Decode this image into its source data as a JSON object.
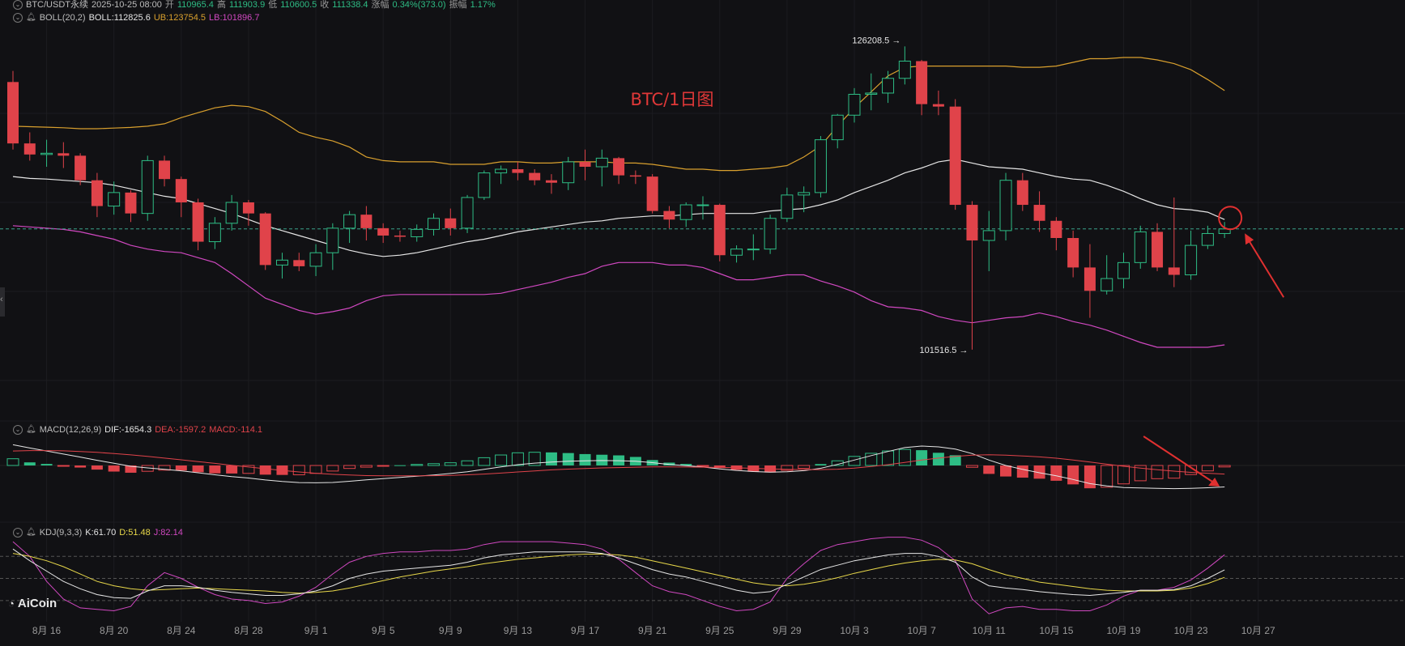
{
  "header": {
    "symbol": "BTC/USDT永续",
    "datetime": "2025-10-25 08:00",
    "open_label": "开",
    "open": "110965.4",
    "high_label": "高",
    "high": "111903.9",
    "low_label": "低",
    "low": "110600.5",
    "close_label": "收",
    "close": "111338.4",
    "change_label": "涨幅",
    "change": "0.34%(373.0)",
    "amp_label": "振幅",
    "amp": "1.17%"
  },
  "boll": {
    "name": "BOLL(20,2)",
    "mid": "BOLL:112825.6",
    "ub": "UB:123754.5",
    "lb": "LB:101896.7"
  },
  "macd": {
    "name": "MACD(12,26,9)",
    "dif": "DIF:-1654.3",
    "dea": "DEA:-1597.2",
    "macd": "MACD:-114.1"
  },
  "kdj": {
    "name": "KDJ(9,3,3)",
    "k": "K:61.70",
    "d": "D:51.48",
    "j": "J:82.14"
  },
  "logo": "AiCoin",
  "colors": {
    "up": "#2ebd85",
    "down": "#e0434a",
    "ub": "#d9a02e",
    "mid": "#e6e6e6",
    "lb": "#d048c0",
    "dif": "#e6e6e6",
    "dea": "#e0434a",
    "k": "#e6e6e6",
    "d": "#e8d84a",
    "j": "#d048c0",
    "annotation": "#e03030"
  },
  "chart_data": {
    "type": "candlestick",
    "title": "BTC/1日图",
    "dates": [
      "08-14",
      "08-15",
      "08-16",
      "08-17",
      "08-18",
      "08-19",
      "08-20",
      "08-21",
      "08-22",
      "08-23",
      "08-24",
      "08-25",
      "08-26",
      "08-27",
      "08-28",
      "08-29",
      "08-30",
      "08-31",
      "09-01",
      "09-02",
      "09-03",
      "09-04",
      "09-05",
      "09-06",
      "09-07",
      "09-08",
      "09-09",
      "09-10",
      "09-11",
      "09-12",
      "09-13",
      "09-14",
      "09-15",
      "09-16",
      "09-17",
      "09-18",
      "09-19",
      "09-20",
      "09-21",
      "09-22",
      "09-23",
      "09-24",
      "09-25",
      "09-26",
      "09-27",
      "09-28",
      "09-29",
      "09-30",
      "10-01",
      "10-02",
      "10-03",
      "10-04",
      "10-05",
      "10-06",
      "10-07",
      "10-08",
      "10-09",
      "10-10",
      "10-11",
      "10-12",
      "10-13",
      "10-14",
      "10-15",
      "10-16",
      "10-17",
      "10-18",
      "10-19",
      "10-20",
      "10-21",
      "10-22",
      "10-23",
      "10-24",
      "10-25"
    ],
    "open": [
      123300,
      118300,
      117400,
      117500,
      117300,
      115300,
      113200,
      114300,
      112600,
      116900,
      115400,
      113500,
      110300,
      111800,
      113500,
      112600,
      108400,
      108800,
      108300,
      109400,
      111400,
      112500,
      111400,
      110800,
      110700,
      111300,
      112200,
      111400,
      113900,
      115900,
      116200,
      115900,
      115300,
      115100,
      116800,
      116400,
      117100,
      115700,
      115600,
      112800,
      112100,
      113300,
      113300,
      109200,
      109700,
      109700,
      112200,
      114100,
      114300,
      118600,
      120600,
      122300,
      122400,
      123600,
      125000,
      121500,
      121300,
      113300,
      110400,
      111200,
      115300,
      113300,
      112000,
      110600,
      108200,
      106300,
      107300,
      108600,
      111100,
      108200,
      107600,
      110000,
      110965
    ],
    "close": [
      118300,
      117400,
      117500,
      117300,
      115300,
      113200,
      114300,
      112600,
      116900,
      115400,
      113500,
      110300,
      111800,
      113500,
      112600,
      108400,
      108800,
      108300,
      109400,
      111400,
      112500,
      111400,
      110800,
      110700,
      111300,
      112200,
      111400,
      113900,
      115900,
      116200,
      115900,
      115300,
      115100,
      116800,
      116400,
      117100,
      115700,
      115600,
      112800,
      112100,
      113300,
      113300,
      109200,
      109700,
      109700,
      112200,
      114100,
      114300,
      118600,
      120600,
      122300,
      122400,
      123600,
      125000,
      121500,
      121300,
      113300,
      110400,
      111200,
      115300,
      113300,
      112000,
      110600,
      108200,
      106300,
      107300,
      108600,
      111100,
      108200,
      107600,
      110000,
      110965,
      111338
    ],
    "high": [
      124200,
      119200,
      118600,
      118400,
      117500,
      115900,
      115200,
      114500,
      117300,
      117300,
      115600,
      113800,
      112300,
      114100,
      113700,
      112700,
      109400,
      109400,
      110100,
      111800,
      112800,
      113200,
      111800,
      111200,
      111700,
      112600,
      113000,
      114100,
      116100,
      116500,
      116800,
      116200,
      115800,
      117200,
      117800,
      117800,
      117200,
      116100,
      115800,
      113200,
      113500,
      114000,
      113400,
      110000,
      110900,
      112500,
      114700,
      114800,
      118900,
      120700,
      122800,
      124000,
      124200,
      126200,
      125100,
      122600,
      121900,
      113600,
      112800,
      115900,
      115900,
      114400,
      112300,
      111200,
      110100,
      109200,
      109400,
      111600,
      111800,
      113900,
      111200,
      111600,
      111904
    ],
    "low": [
      117800,
      116900,
      116400,
      116300,
      114900,
      112300,
      112500,
      111900,
      112000,
      114800,
      112300,
      109600,
      109700,
      111200,
      111600,
      108000,
      107300,
      107900,
      107500,
      108000,
      110200,
      110400,
      110200,
      110300,
      110300,
      110800,
      110800,
      111000,
      113700,
      115000,
      115300,
      114900,
      114200,
      114500,
      115300,
      114800,
      115000,
      115000,
      112600,
      111400,
      111500,
      112100,
      108700,
      108600,
      108800,
      109300,
      111900,
      112700,
      113900,
      117900,
      120000,
      121000,
      121600,
      123100,
      120600,
      120600,
      112900,
      101516,
      107900,
      110400,
      112800,
      111100,
      109600,
      107400,
      104100,
      106000,
      106500,
      108100,
      107900,
      106600,
      107200,
      109700,
      110600
    ],
    "boll_ub": [
      119700,
      119660,
      119620,
      119580,
      119500,
      119500,
      119550,
      119600,
      119700,
      119900,
      120400,
      120800,
      121200,
      121400,
      121300,
      120900,
      120100,
      119200,
      118800,
      118500,
      118000,
      117200,
      116900,
      116800,
      116800,
      116800,
      116600,
      116600,
      116600,
      116800,
      116800,
      116700,
      116700,
      116800,
      116800,
      116800,
      116700,
      116700,
      116600,
      116400,
      116200,
      116200,
      116100,
      116100,
      116200,
      116300,
      116500,
      117200,
      118100,
      119700,
      121200,
      122500,
      123800,
      124500,
      124600,
      124600,
      124600,
      124600,
      124600,
      124600,
      124500,
      124500,
      124600,
      124900,
      125200,
      125200,
      125300,
      125300,
      125100,
      124800,
      124300,
      123500,
      122600
    ],
    "boll_mid": [
      115600,
      115450,
      115400,
      115300,
      115200,
      115100,
      114900,
      114600,
      114300,
      114000,
      113800,
      113400,
      113000,
      112600,
      112100,
      111600,
      111200,
      110800,
      110400,
      110000,
      109600,
      109300,
      109100,
      109200,
      109400,
      109700,
      110000,
      110300,
      110500,
      110800,
      111100,
      111300,
      111500,
      111700,
      111900,
      112000,
      112200,
      112300,
      112400,
      112400,
      112500,
      112600,
      112600,
      112600,
      112600,
      112800,
      112900,
      113000,
      113300,
      113700,
      114300,
      114800,
      115300,
      115900,
      116300,
      116800,
      117000,
      116700,
      116400,
      116300,
      116200,
      115900,
      115600,
      115400,
      115300,
      114900,
      114400,
      113800,
      113300,
      113000,
      112900,
      112700,
      112100
    ],
    "boll_lb": [
      111600,
      111500,
      111400,
      111300,
      111100,
      110800,
      110500,
      110000,
      109700,
      109500,
      109400,
      109000,
      108600,
      107700,
      106700,
      105700,
      105200,
      104700,
      104400,
      104600,
      104900,
      105500,
      105900,
      106000,
      106000,
      106000,
      106000,
      106000,
      106000,
      106100,
      106400,
      106700,
      107000,
      107400,
      107700,
      108300,
      108600,
      108600,
      108600,
      108400,
      108400,
      108200,
      107700,
      107200,
      107200,
      107400,
      107600,
      107600,
      107100,
      106700,
      106200,
      105500,
      105000,
      104900,
      104700,
      104200,
      103900,
      103700,
      103900,
      104100,
      104200,
      104500,
      104200,
      103800,
      103500,
      103100,
      102600,
      102100,
      101700,
      101700,
      101700,
      101700,
      101900
    ],
    "macd_hist": [
      520,
      240,
      120,
      -60,
      -160,
      -320,
      -470,
      -560,
      -450,
      -360,
      -390,
      -520,
      -610,
      -620,
      -610,
      -710,
      -730,
      -720,
      -610,
      -430,
      -230,
      -130,
      -60,
      20,
      80,
      140,
      210,
      360,
      600,
      810,
      980,
      1020,
      1010,
      960,
      880,
      830,
      780,
      660,
      420,
      220,
      120,
      -50,
      -200,
      -340,
      -480,
      -540,
      -380,
      -220,
      110,
      360,
      700,
      940,
      1120,
      1240,
      1180,
      980,
      790,
      -140,
      -650,
      -850,
      -940,
      -1020,
      -1180,
      -1460,
      -1760,
      -1680,
      -1420,
      -1180,
      -1020,
      -980,
      -700,
      -420,
      -114
    ],
    "macd_dif": [
      1600,
      1350,
      1120,
      880,
      650,
      400,
      170,
      -60,
      -190,
      -300,
      -410,
      -560,
      -720,
      -860,
      -970,
      -1120,
      -1240,
      -1320,
      -1340,
      -1310,
      -1220,
      -1110,
      -1010,
      -920,
      -830,
      -730,
      -620,
      -480,
      -300,
      -110,
      60,
      180,
      270,
      330,
      360,
      380,
      370,
      330,
      220,
      80,
      -20,
      -120,
      -260,
      -380,
      -470,
      -520,
      -480,
      -400,
      -220,
      80,
      420,
      760,
      1080,
      1380,
      1500,
      1440,
      1260,
      920,
      420,
      0,
      -300,
      -560,
      -800,
      -1080,
      -1400,
      -1580,
      -1700,
      -1740,
      -1760,
      -1790,
      -1760,
      -1720,
      -1654
    ],
    "macd_dea": [
      1120,
      1150,
      1150,
      1130,
      1080,
      1010,
      920,
      820,
      700,
      570,
      440,
      300,
      160,
      20,
      -120,
      -250,
      -380,
      -500,
      -600,
      -680,
      -740,
      -780,
      -800,
      -800,
      -800,
      -790,
      -760,
      -720,
      -660,
      -590,
      -500,
      -420,
      -340,
      -280,
      -230,
      -190,
      -160,
      -130,
      -110,
      -110,
      -120,
      -130,
      -150,
      -180,
      -220,
      -270,
      -300,
      -320,
      -320,
      -290,
      -200,
      -80,
      60,
      240,
      420,
      570,
      700,
      800,
      830,
      800,
      740,
      660,
      560,
      420,
      260,
      100,
      -60,
      -200,
      -330,
      -440,
      -530,
      -600,
      -1597
    ],
    "kdj_k": [
      90,
      74,
      60,
      46,
      36,
      28,
      24,
      23,
      33,
      40,
      40,
      38,
      34,
      31,
      29,
      27,
      27,
      29,
      33,
      40,
      50,
      56,
      60,
      62,
      64,
      66,
      68,
      72,
      78,
      82,
      84,
      86,
      86,
      86,
      86,
      84,
      78,
      70,
      62,
      56,
      52,
      46,
      40,
      34,
      30,
      32,
      42,
      52,
      62,
      68,
      74,
      78,
      82,
      84,
      84,
      80,
      72,
      52,
      40,
      37,
      35,
      32,
      30,
      28,
      27,
      29,
      31,
      34,
      34,
      35,
      40,
      50,
      61.7
    ],
    "kdj_d": [
      84,
      80,
      74,
      66,
      56,
      46,
      40,
      36,
      34,
      35,
      36,
      37,
      36,
      35,
      34,
      33,
      31,
      30,
      31,
      33,
      37,
      42,
      47,
      52,
      56,
      60,
      63,
      66,
      70,
      73,
      76,
      78,
      80,
      82,
      83,
      83,
      82,
      79,
      74,
      69,
      64,
      59,
      54,
      49,
      44,
      41,
      40,
      42,
      46,
      51,
      57,
      62,
      67,
      71,
      74,
      76,
      75,
      70,
      62,
      55,
      50,
      45,
      42,
      39,
      36,
      34,
      33,
      33,
      33,
      34,
      37,
      43,
      51.48
    ],
    "kdj_j": [
      100,
      80,
      46,
      22,
      10,
      8,
      6,
      12,
      40,
      58,
      50,
      38,
      28,
      22,
      20,
      16,
      18,
      26,
      38,
      56,
      72,
      80,
      84,
      86,
      86,
      88,
      88,
      90,
      96,
      100,
      100,
      100,
      100,
      98,
      96,
      90,
      76,
      58,
      40,
      32,
      28,
      20,
      12,
      6,
      8,
      18,
      50,
      70,
      88,
      96,
      100,
      104,
      106,
      106,
      102,
      92,
      74,
      22,
      2,
      10,
      12,
      8,
      8,
      6,
      6,
      14,
      26,
      34,
      34,
      38,
      48,
      64,
      82.14
    ],
    "kdj_levels": [
      80,
      50,
      20
    ],
    "x_ticks": [
      {
        "date": "08-16",
        "label": "8月 16"
      },
      {
        "date": "08-20",
        "label": "8月 20"
      },
      {
        "date": "08-24",
        "label": "8月 24"
      },
      {
        "date": "08-28",
        "label": "8月 28"
      },
      {
        "date": "09-01",
        "label": "9月 1"
      },
      {
        "date": "09-05",
        "label": "9月 5"
      },
      {
        "date": "09-09",
        "label": "9月 9"
      },
      {
        "date": "09-13",
        "label": "9月 13"
      },
      {
        "date": "09-17",
        "label": "9月 17"
      },
      {
        "date": "09-21",
        "label": "9月 21"
      },
      {
        "date": "09-25",
        "label": "9月 25"
      },
      {
        "date": "09-29",
        "label": "9月 29"
      },
      {
        "date": "10-03",
        "label": "10月 3"
      },
      {
        "date": "10-07",
        "label": "10月 7"
      },
      {
        "date": "10-11",
        "label": "10月 11"
      },
      {
        "date": "10-15",
        "label": "10月 15"
      },
      {
        "date": "10-19",
        "label": "10月 19"
      },
      {
        "date": "10-23",
        "label": "10月 23"
      },
      {
        "date": "10-27",
        "label": "10月 27"
      }
    ],
    "annotations": {
      "high_mark": "126208.5 →",
      "low_mark": "101516.5 →",
      "current_price": 111338
    }
  }
}
